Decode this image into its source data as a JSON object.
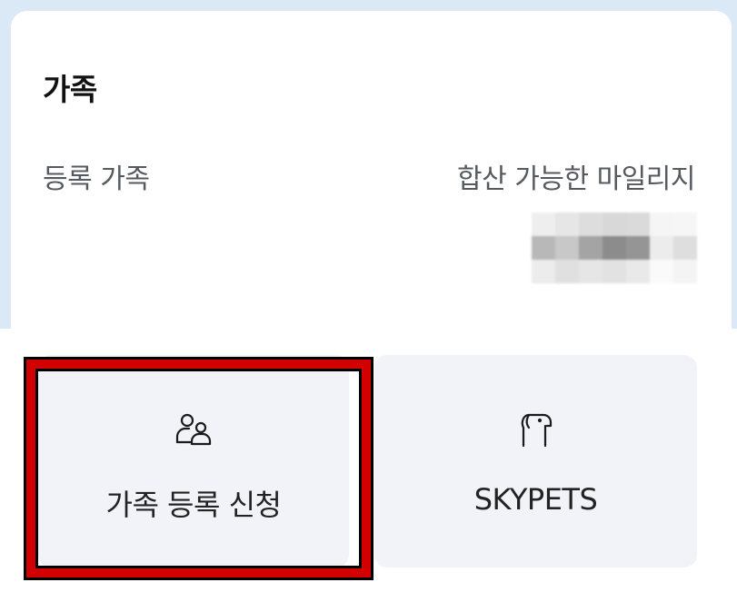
{
  "family_section": {
    "title": "가족",
    "registered_label": "등록 가족",
    "combinable_mileage_label": "합산 가능한 마일리지"
  },
  "actions": [
    {
      "label": "가족 등록 신청",
      "icon": "family-users-icon"
    },
    {
      "label": "SKYPETS",
      "icon": "dog-icon"
    }
  ],
  "colors": {
    "background_top": "#dbe9f6",
    "tile_bg": "#f1f3f8",
    "highlight": "#d20000"
  }
}
